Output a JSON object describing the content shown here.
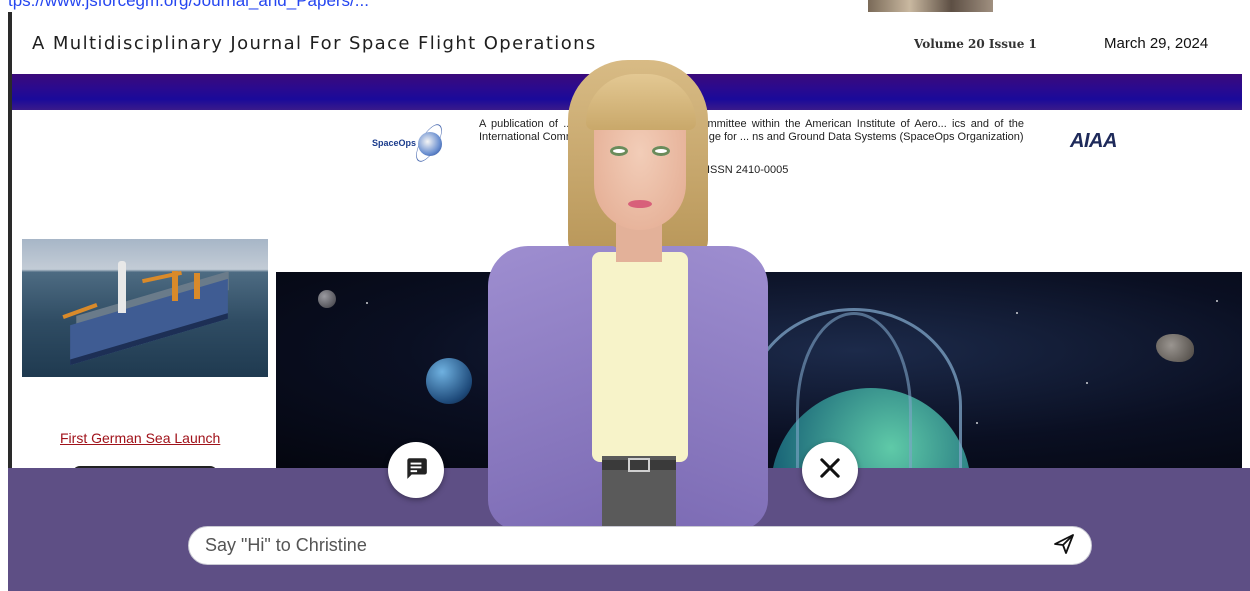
{
  "browser": {
    "url_partial": "tps://www.jsforcegm.org/Journal_and_Papers/...",
    "url_color": "#2546f0"
  },
  "journal": {
    "title": "A Multidisciplinary Journal For Space Flight Operations",
    "volume": "Volume 20 Issue 1",
    "date": "March 29, 2024",
    "band_color": "#2a0a8f"
  },
  "publication": {
    "text": "A publication of ... d Support, a technical committee within the American Institute of Aero... ics and of the International Committee on Technical Interchange for ... ns and Ground Data Systems (SpaceOps Organization)",
    "issn": "ISSN 2410-0005",
    "spaceops_logo_text": "SpaceOps",
    "aiaa_logo_text": "AIAA"
  },
  "sidebar": {
    "feature_link": "First German Sea Launch",
    "feature_image_icon": "ship-photo"
  },
  "assistant": {
    "name": "Christine",
    "chat_placeholder": "Say \"Hi\" to Christine",
    "chat_icon": "chat-bubble-icon",
    "close_icon": "close-icon",
    "send_icon": "send-icon",
    "overlay_color": "#5e4f85"
  }
}
